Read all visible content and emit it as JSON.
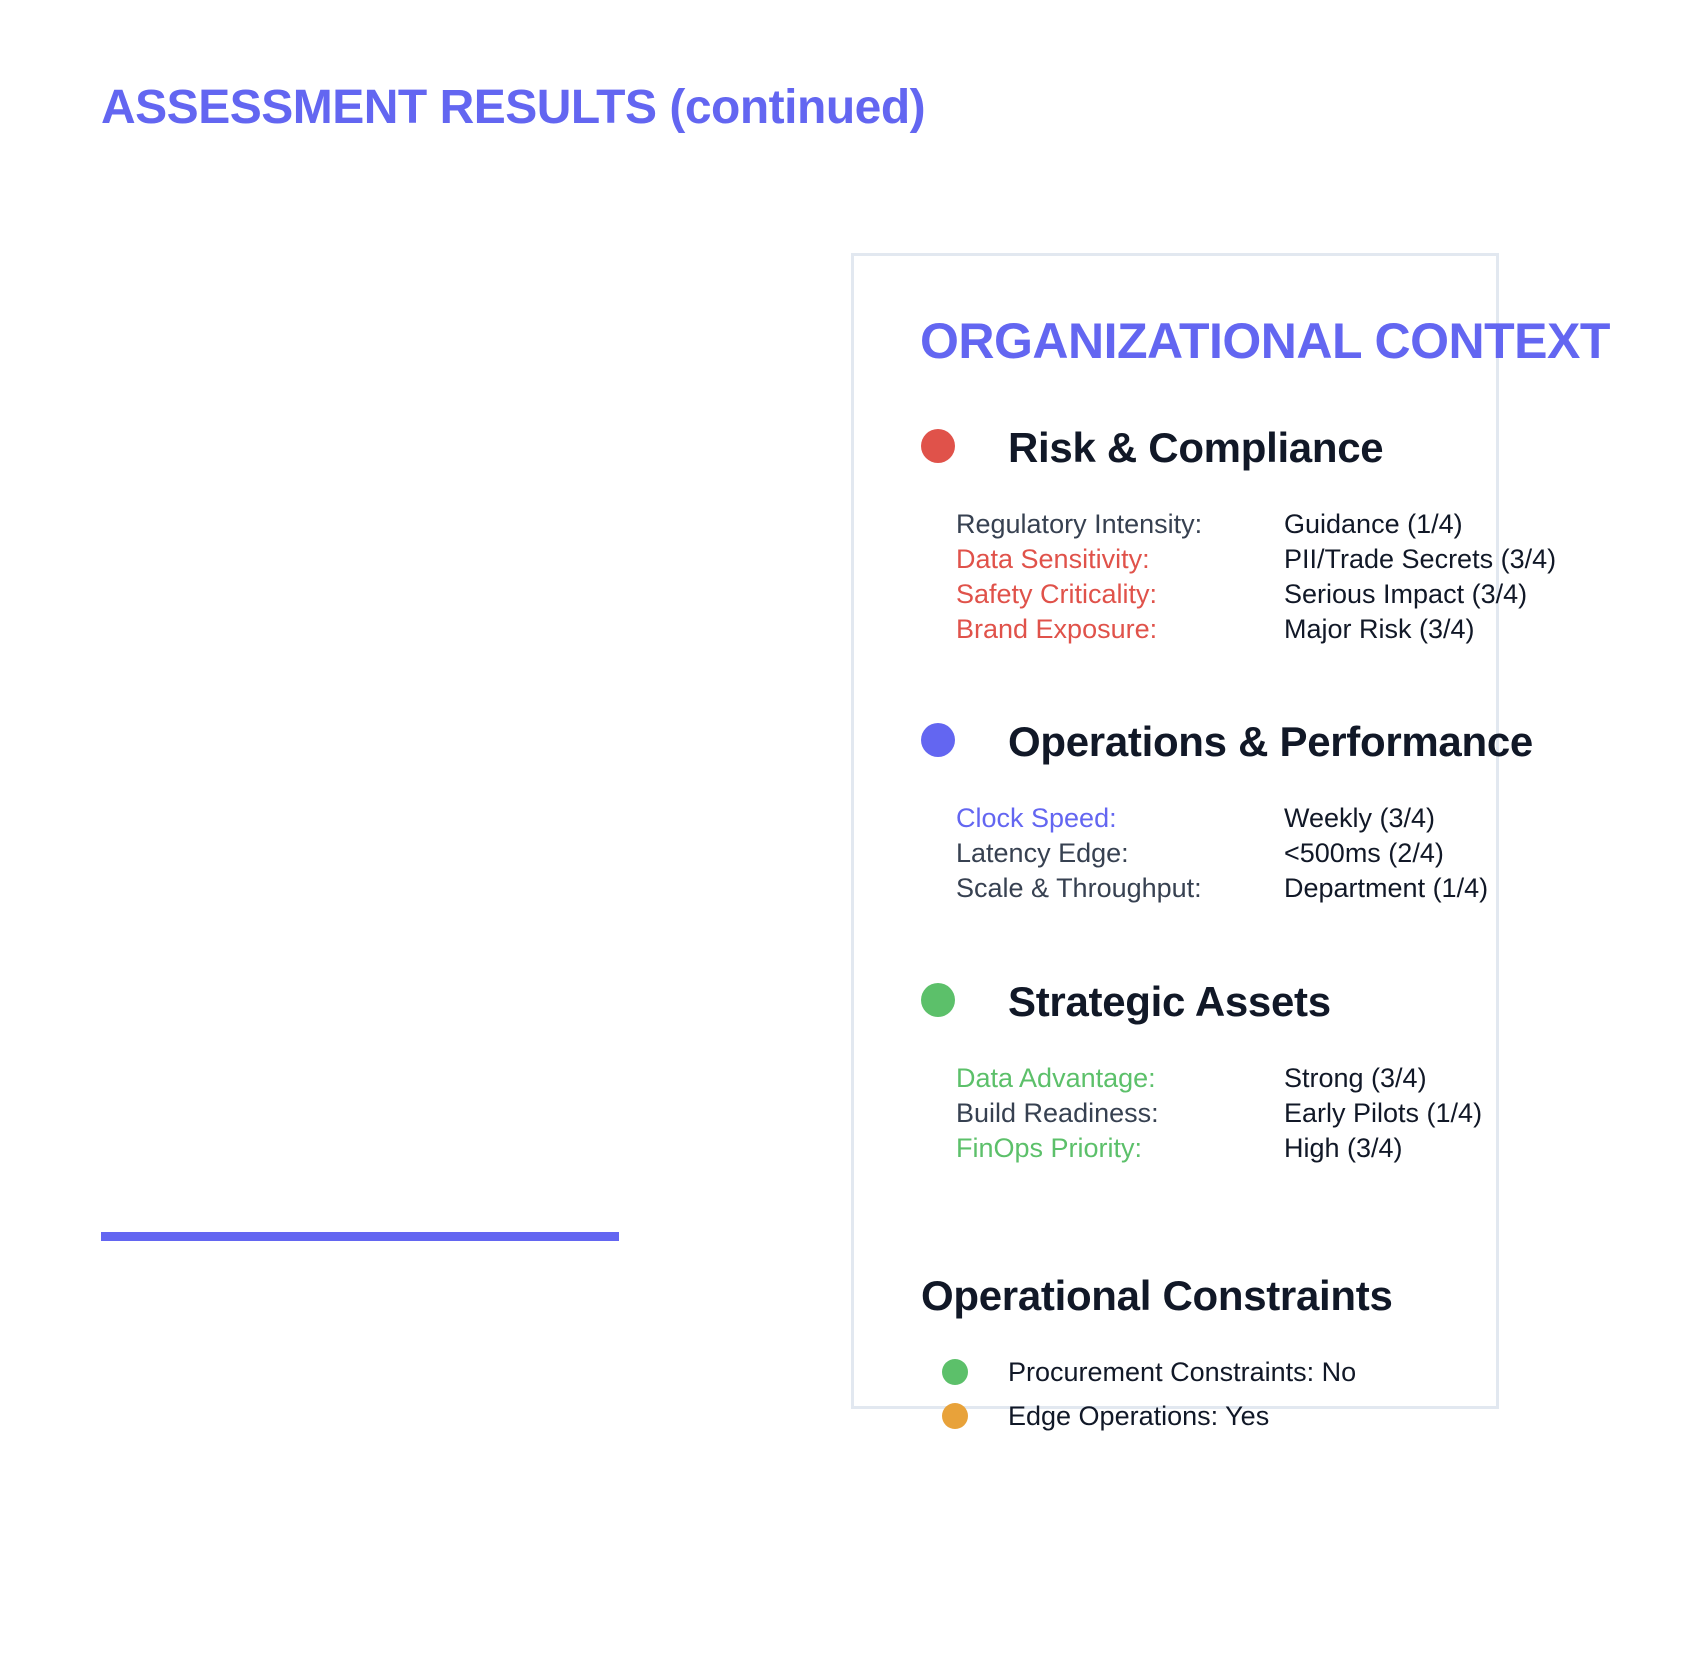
{
  "page": {
    "title": "ASSESSMENT RESULTS (continued)"
  },
  "colors": {
    "accent": "#6366f1",
    "risk": "#e0524a",
    "operations": "#6366f1",
    "strategic": "#5cc06a",
    "neutral_label": "#374151",
    "warning": "#e8a23a"
  },
  "context": {
    "title": "ORGANIZATIONAL CONTEXT",
    "sections": [
      {
        "heading": "Risk & Compliance",
        "rows": [
          {
            "label": "Regulatory Intensity:",
            "value": "Guidance (1/4)",
            "highlighted": false
          },
          {
            "label": "Data Sensitivity:",
            "value": "PII/Trade Secrets (3/4)",
            "highlighted": true
          },
          {
            "label": "Safety Criticality:",
            "value": "Serious Impact (3/4)",
            "highlighted": true
          },
          {
            "label": "Brand Exposure:",
            "value": "Major Risk (3/4)",
            "highlighted": true
          }
        ]
      },
      {
        "heading": "Operations & Performance",
        "rows": [
          {
            "label": "Clock Speed:",
            "value": "Weekly (3/4)",
            "highlighted": true
          },
          {
            "label": "Latency Edge:",
            "value": "<500ms (2/4)",
            "highlighted": false
          },
          {
            "label": "Scale & Throughput:",
            "value": "Department (1/4)",
            "highlighted": false
          }
        ]
      },
      {
        "heading": "Strategic Assets",
        "rows": [
          {
            "label": "Data Advantage:",
            "value": "Strong (3/4)",
            "highlighted": true
          },
          {
            "label": "Build Readiness:",
            "value": "Early Pilots (1/4)",
            "highlighted": false
          },
          {
            "label": "FinOps Priority:",
            "value": "High (3/4)",
            "highlighted": true
          }
        ]
      }
    ]
  },
  "constraints": {
    "heading": "Operational Constraints",
    "items": [
      {
        "text": "Procurement Constraints: No",
        "status": "ok"
      },
      {
        "text": "Edge Operations: Yes",
        "status": "warning"
      }
    ]
  }
}
